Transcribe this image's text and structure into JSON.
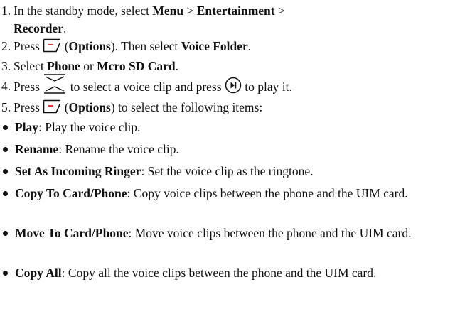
{
  "steps": [
    {
      "num": "1.",
      "t1": "In the standby mode, select ",
      "b1": "Menu",
      "t2": " > ",
      "b2": "Entertainment",
      "t3": " > ",
      "b3": "Recorder",
      "t4": "."
    },
    {
      "num": "2.",
      "t1": "Press ",
      "icon": "left-softkey-icon",
      "t2": " (",
      "b1": "Options",
      "t3": "). Then select ",
      "b2": "Voice Folder",
      "t4": "."
    },
    {
      "num": "3.",
      "t1": "Select ",
      "b1": "Phone",
      "t2": " or ",
      "b2": "Mcro SD Card",
      "t3": "."
    },
    {
      "num": "4.",
      "t1": "Press ",
      "icon1": "up-down-navigation-key-icon",
      "t2": " to select a voice clip and press ",
      "icon2": "play-center-key-icon",
      "t3": " to play it."
    },
    {
      "num": "5.",
      "t1": "Press ",
      "icon": "left-softkey-icon",
      "t2": " (",
      "b1": "Options",
      "t3": ") to select the following items:"
    }
  ],
  "bullets": [
    {
      "term": "Play",
      "desc": ": Play the voice clip."
    },
    {
      "term": "Rename",
      "desc": ": Rename the voice clip."
    },
    {
      "term": "Set As Incoming Ringer",
      "desc": ": Set the voice clip as the ringtone."
    },
    {
      "term": "Copy To Card/Phone",
      "desc": ": Copy voice clips between the phone and the UIM card."
    },
    {
      "term": "Move To Card/Phone",
      "desc": ": Move voice clips between the phone and the UIM card."
    },
    {
      "term": "Copy All",
      "desc": ": Copy all the voice clips between the phone and the UIM card."
    }
  ],
  "colors": {
    "text": "#111111",
    "icon_accent": "#e0303a"
  }
}
